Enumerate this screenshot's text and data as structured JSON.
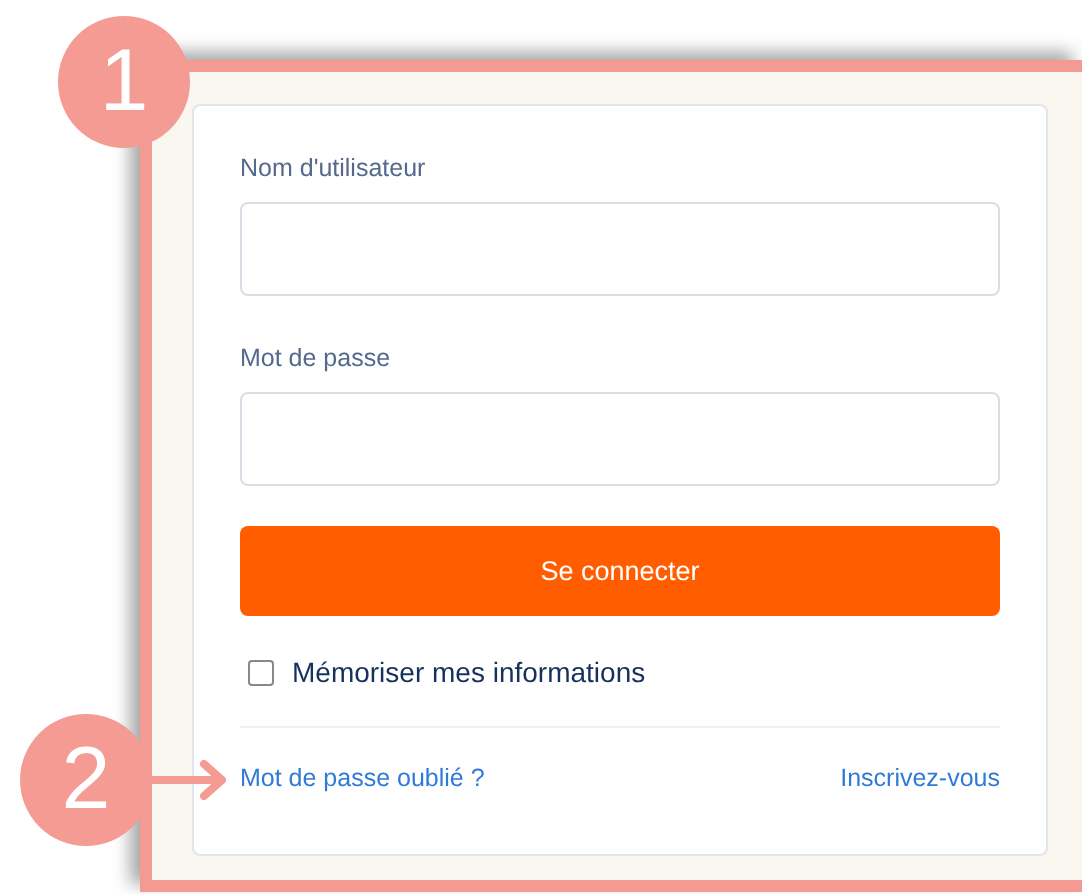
{
  "badges": [
    {
      "label": "1"
    },
    {
      "label": "2"
    }
  ],
  "login_form": {
    "fields": [
      {
        "label": "Nom d'utilisateur"
      },
      {
        "label": "Mot de passe"
      }
    ],
    "submit_button": "Se connecter",
    "remember_me": {
      "label": "Mémoriser mes informations",
      "checked": false
    },
    "links": [
      "Mot de passe oublié ?",
      "Inscrivez-vous"
    ]
  }
}
